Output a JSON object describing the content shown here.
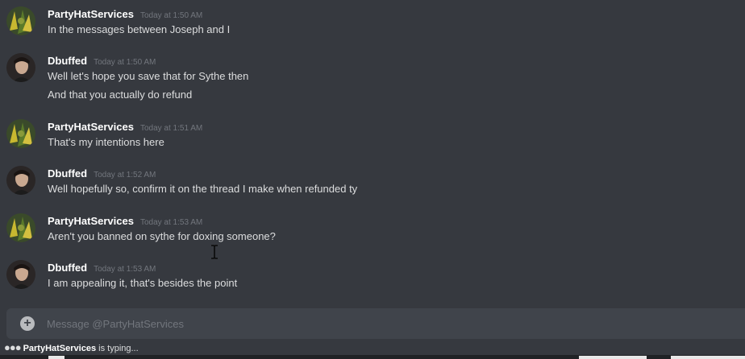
{
  "messages": [
    {
      "author": "PartyHatServices",
      "timestamp": "Today at 1:50 AM",
      "avatar_icon": "party-hat-avatar-icon",
      "lines": [
        "In the messages between Joseph and I"
      ]
    },
    {
      "author": "Dbuffed",
      "timestamp": "Today at 1:50 AM",
      "avatar_icon": "person-avatar-icon",
      "lines": [
        "Well let's hope you save that for Sythe then",
        "And that you actually do refund"
      ]
    },
    {
      "author": "PartyHatServices",
      "timestamp": "Today at 1:51 AM",
      "avatar_icon": "party-hat-avatar-icon",
      "lines": [
        "That's my intentions here"
      ]
    },
    {
      "author": "Dbuffed",
      "timestamp": "Today at 1:52 AM",
      "avatar_icon": "person-avatar-icon",
      "lines": [
        "Well hopefully so, confirm it on the thread I make when refunded ty"
      ]
    },
    {
      "author": "PartyHatServices",
      "timestamp": "Today at 1:53 AM",
      "avatar_icon": "party-hat-avatar-icon",
      "lines": [
        "Aren't you banned on sythe for doxing someone?"
      ]
    },
    {
      "author": "Dbuffed",
      "timestamp": "Today at 1:53 AM",
      "avatar_icon": "person-avatar-icon",
      "lines": [
        "I am appealing it, that's besides the point"
      ]
    }
  ],
  "composer": {
    "placeholder": "Message @PartyHatServices",
    "add_icon": "plus-circle-icon"
  },
  "typing": {
    "user": "PartyHatServices",
    "suffix": "is typing..."
  },
  "colors": {
    "background": "#36393f",
    "composer_bg": "#40444b",
    "username": "#ffffff",
    "timestamp": "#72767d",
    "text": "#dcddde"
  }
}
